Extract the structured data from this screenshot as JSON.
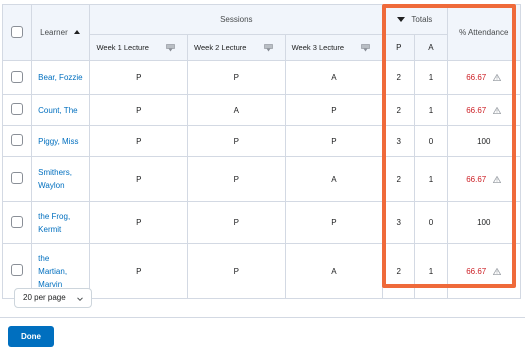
{
  "header": {
    "learner": "Learner",
    "sessions": "Sessions",
    "totals": "Totals",
    "attendance": "% Attendance",
    "weeks": [
      "Week 1 Lecture",
      "Week 2 Lecture",
      "Week 3 Lecture"
    ],
    "present": "P",
    "absent": "A"
  },
  "rows": [
    {
      "name_lines": [
        "Bear, Fozzie"
      ],
      "marks": [
        "P",
        "P",
        "A"
      ],
      "p": "2",
      "a": "1",
      "attendance": "66.67",
      "low": true
    },
    {
      "name_lines": [
        "Count, The"
      ],
      "marks": [
        "P",
        "A",
        "P"
      ],
      "p": "2",
      "a": "1",
      "attendance": "66.67",
      "low": true
    },
    {
      "name_lines": [
        "Piggy, Miss"
      ],
      "marks": [
        "P",
        "P",
        "P"
      ],
      "p": "3",
      "a": "0",
      "attendance": "100",
      "low": false
    },
    {
      "name_lines": [
        "Smithers,",
        "Waylon"
      ],
      "marks": [
        "P",
        "P",
        "A"
      ],
      "p": "2",
      "a": "1",
      "attendance": "66.67",
      "low": true
    },
    {
      "name_lines": [
        "the Frog,",
        "Kermit"
      ],
      "marks": [
        "P",
        "P",
        "P"
      ],
      "p": "3",
      "a": "0",
      "attendance": "100",
      "low": false
    },
    {
      "name_lines": [
        "the",
        "Martian,",
        "Marvin"
      ],
      "marks": [
        "P",
        "P",
        "A"
      ],
      "p": "2",
      "a": "1",
      "attendance": "66.67",
      "low": true
    }
  ],
  "pagination": {
    "per_page": "20 per page"
  },
  "footer": {
    "done_label": "Done"
  },
  "colors": {
    "link": "#006fbf",
    "low_attendance": "#cd2026",
    "highlight": "#ef6a3a",
    "primary_button": "#006fbf"
  }
}
